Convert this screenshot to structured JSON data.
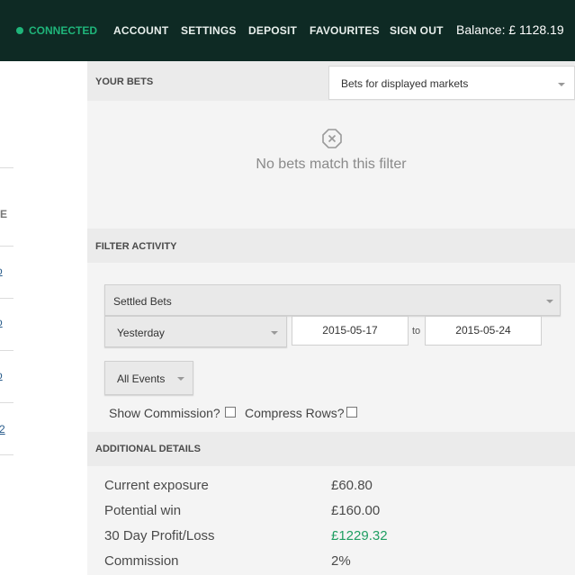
{
  "topbar": {
    "status": "CONNECTED",
    "nav": [
      "ACCOUNT",
      "SETTINGS",
      "DEPOSIT",
      "FAVOURITES",
      "SIGN OUT"
    ],
    "balance": "Balance:  £ 1128.19",
    "status_color": "#1fb57a",
    "bg_color": "#0e2a24"
  },
  "left": {
    "frag1": "E",
    "frag2": "o",
    "frag3": "o",
    "frag4": "o",
    "frag5": "2"
  },
  "your_bets": {
    "title": "YOUR BETS",
    "filter_value": "Bets for displayed markets",
    "empty_message": "No bets match this filter"
  },
  "filter_activity": {
    "title": "FILTER ACTIVITY",
    "bet_type": "Settled Bets",
    "period": "Yesterday",
    "date_from": "2015-05-17",
    "to_label": "to",
    "date_to": "2015-05-24",
    "events": "All Events",
    "show_commission": "Show Commission?",
    "compress_rows": "Compress Rows?"
  },
  "additional_details": {
    "title": "ADDITIONAL DETAILS",
    "rows": [
      {
        "label": "Current exposure",
        "value": "£60.80"
      },
      {
        "label": "Potential win",
        "value": "£160.00"
      },
      {
        "label": "30 Day Profit/Loss",
        "value": "£1229.32"
      },
      {
        "label": "Commission",
        "value": "2%"
      }
    ],
    "profit_color": "#1f9e62"
  }
}
